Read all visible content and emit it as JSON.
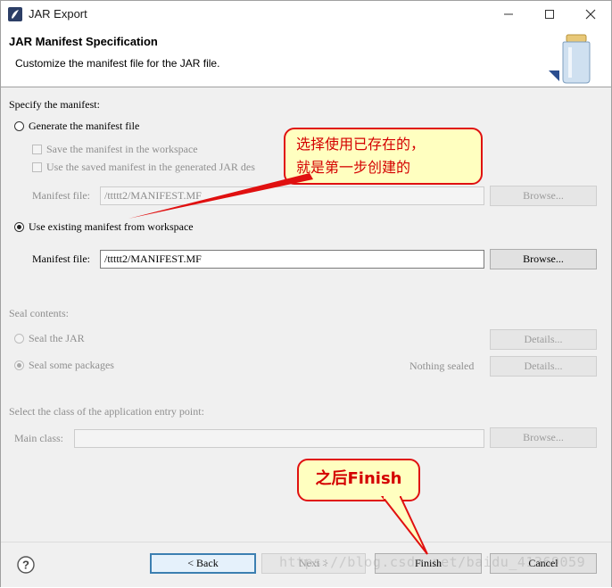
{
  "window": {
    "title": "JAR Export"
  },
  "header": {
    "title": "JAR Manifest Specification",
    "description": "Customize the manifest file for the JAR file."
  },
  "manifest": {
    "section_label": "Specify the manifest:",
    "generate_option": {
      "label": "Generate the manifest file",
      "selected": false
    },
    "save_in_workspace": "Save the manifest in the workspace",
    "use_saved_manifest": "Use the saved manifest in the generated JAR des",
    "generate_file_label": "Manifest file:",
    "generate_file_value": "/ttttt2/MANIFEST.MF",
    "generate_browse": "Browse...",
    "existing_option": {
      "label": "Use existing manifest from workspace",
      "selected": true
    },
    "existing_file_label": "Manifest file:",
    "existing_file_value": "/ttttt2/MANIFEST.MF",
    "existing_browse": "Browse..."
  },
  "seal": {
    "section_label": "Seal contents:",
    "seal_jar": "Seal the JAR",
    "seal_packages": "Seal some packages",
    "nothing_sealed": "Nothing sealed",
    "details_1": "Details...",
    "details_2": "Details..."
  },
  "entry_point": {
    "section_label": "Select the class of the application entry point:",
    "main_class_label": "Main class:",
    "main_class_value": "",
    "browse": "Browse..."
  },
  "callouts": {
    "top_line1": "选择使用已存在的，",
    "top_line2": "就是第一步创建的",
    "bottom": "之后Finish"
  },
  "footer": {
    "back": "< Back",
    "next": "Next >",
    "finish": "Finish",
    "cancel": "Cancel"
  },
  "watermark": "https://blog.csdn.net/baidu_41369059",
  "icons": {
    "app": "eclipse-jar-icon",
    "minimize": "minimize-icon",
    "maximize": "maximize-icon",
    "close": "close-icon",
    "banner": "jar-banner-icon",
    "help": "help-icon"
  },
  "colors": {
    "callout_border": "#e01010",
    "callout_fill": "#ffffc0",
    "callout_text": "#d40000",
    "panel": "#f0f0f0",
    "default_button_border": "#3c7fb1"
  }
}
